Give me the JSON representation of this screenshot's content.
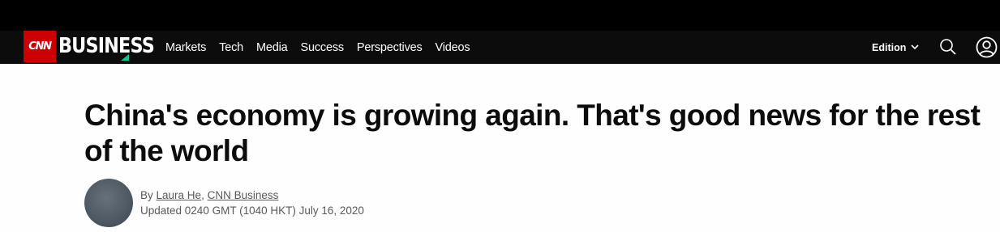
{
  "header": {
    "logo_primary": "CNN",
    "logo_secondary": "BUSINESS",
    "nav_items": [
      "Markets",
      "Tech",
      "Media",
      "Success",
      "Perspectives",
      "Videos"
    ],
    "edition_label": "Edition",
    "icons": [
      "chevron-down-icon",
      "search-icon",
      "account-icon"
    ],
    "colors": {
      "brand_red": "#cc0000",
      "accent_green": "#0ec797",
      "nav_bg": "#0c0c0c"
    }
  },
  "article": {
    "headline": "China's economy is growing again. That's good news for the rest of the world",
    "byline_prefix": "By",
    "author": "Laura He",
    "separator": ",",
    "source": "CNN Business",
    "updated": "Updated 0240 GMT (1040 HKT) July 16, 2020"
  }
}
